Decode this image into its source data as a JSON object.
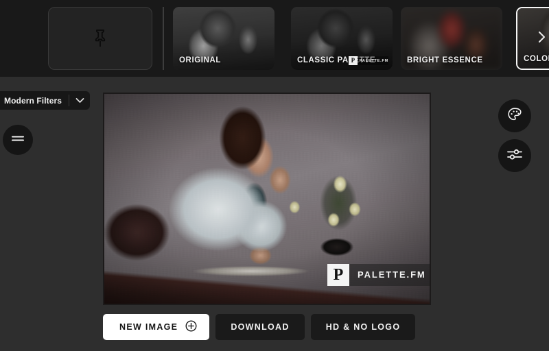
{
  "app": {
    "brand": "PALETTE.FM",
    "brand_mark": "P"
  },
  "filmstrip": {
    "pin_tile": {
      "icon": "pushpin-icon",
      "label": ""
    },
    "next_arrow": {
      "icon": "chevron-right-icon"
    },
    "thumbnails": [
      {
        "label": "ORIGINAL",
        "selected": false,
        "watermark": false,
        "style": "bw"
      },
      {
        "label": "CLASSIC PALETTE",
        "selected": false,
        "watermark": true,
        "style": "bw-dim"
      },
      {
        "label": "BRIGHT ESSENCE",
        "selected": false,
        "watermark": false,
        "style": "blurred"
      },
      {
        "label": "COLOR",
        "selected": true,
        "watermark": false,
        "style": "dark"
      }
    ]
  },
  "left_controls": {
    "filter_select": {
      "value": "Modern Filters",
      "chevron_icon": "chevron-down-icon"
    },
    "menu_button": {
      "icon": "hamburger-menu-icon"
    }
  },
  "right_controls": {
    "palette_button": {
      "icon": "palette-icon"
    },
    "sliders_button": {
      "icon": "sliders-icon"
    }
  },
  "canvas": {
    "watermark": {
      "mark": "P",
      "text": "PALETTE.FM"
    }
  },
  "actions": {
    "new_image": {
      "label": "NEW IMAGE",
      "icon": "plus-circle-icon"
    },
    "download": {
      "label": "DOWNLOAD"
    },
    "hd_no_logo": {
      "label": "HD & NO LOGO"
    }
  },
  "colors": {
    "strip_bg": "#191919",
    "app_bg": "#2e2e2e",
    "button_dark": "#1a1a1a",
    "button_light": "#ffffff",
    "text": "#f2f2f2",
    "selected_border": "#f5f5f5"
  }
}
